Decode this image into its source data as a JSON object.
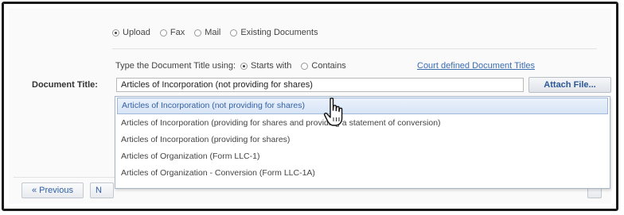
{
  "delivery_options": [
    {
      "label": "Upload",
      "selected": true
    },
    {
      "label": "Fax",
      "selected": false
    },
    {
      "label": "Mail",
      "selected": false
    },
    {
      "label": "Existing Documents",
      "selected": false
    }
  ],
  "match_mode": {
    "prompt": "Type the Document Title using:",
    "options": [
      {
        "label": "Starts with",
        "selected": true
      },
      {
        "label": "Contains",
        "selected": false
      }
    ]
  },
  "court_link": "Court defined Document Titles",
  "document_title": {
    "label": "Document Title:",
    "value": "Articles of Incorporation (not providing for shares)"
  },
  "attach_button": "Attach File...",
  "suggestions": [
    "Articles of Incorporation (not providing for shares)",
    "Articles of Incorporation (providing for shares and providing a statement of conversion)",
    "Articles of Incorporation (providing for shares)",
    "Articles of Organization (Form LLC-1)",
    "Articles of Organization - Conversion (Form LLC-1A)"
  ],
  "selected_suggestion_index": 0,
  "nav": {
    "previous": "« Previous",
    "next": "N"
  },
  "cursor_icon": "hand-pointer-icon"
}
